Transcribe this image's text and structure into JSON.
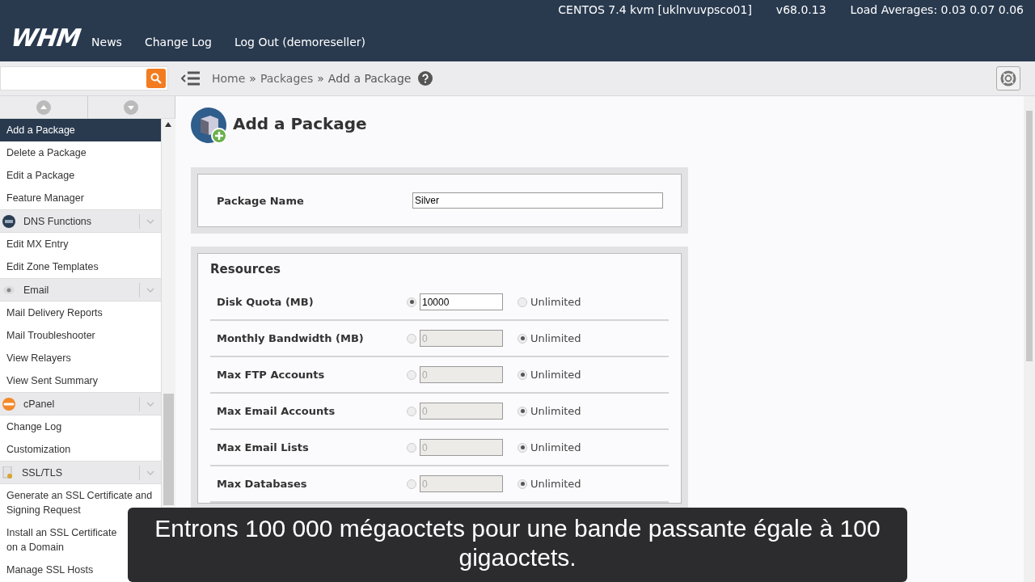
{
  "header": {
    "server_info": "CENTOS 7.4 kvm [uklnvuvpsco01]",
    "version": "v68.0.13",
    "load": "Load Averages: 0.03 0.07 0.06",
    "logo": "WHM",
    "nav": [
      "News",
      "Change Log",
      "Log Out (demoreseller)"
    ]
  },
  "breadcrumb": [
    {
      "kind": "link",
      "text": "Home"
    },
    {
      "kind": "separator",
      "text": "»"
    },
    {
      "kind": "link",
      "text": "Packages"
    },
    {
      "kind": "separator",
      "text": "»"
    },
    {
      "kind": "current",
      "text": "Add a Package"
    }
  ],
  "sidebar": {
    "items": [
      {
        "kind": "link",
        "label": "Add a Package",
        "selected": true
      },
      {
        "kind": "link",
        "label": "Delete a Package",
        "selected": false
      },
      {
        "kind": "link",
        "label": "Edit a Package",
        "selected": false
      },
      {
        "kind": "link",
        "label": "Feature Manager",
        "selected": false
      },
      {
        "kind": "group",
        "label": "DNS Functions"
      },
      {
        "kind": "link",
        "label": "Edit MX Entry",
        "selected": false
      },
      {
        "kind": "link",
        "label": "Edit Zone Templates",
        "selected": false
      },
      {
        "kind": "group",
        "label": "Email"
      },
      {
        "kind": "link",
        "label": "Mail Delivery Reports",
        "selected": false
      },
      {
        "kind": "link",
        "label": "Mail Troubleshooter",
        "selected": false
      },
      {
        "kind": "link",
        "label": "View Relayers",
        "selected": false
      },
      {
        "kind": "link",
        "label": "View Sent Summary",
        "selected": false
      },
      {
        "kind": "group",
        "label": "cPanel"
      },
      {
        "kind": "link",
        "label": "Change Log",
        "selected": false
      },
      {
        "kind": "link",
        "label": "Customization",
        "selected": false
      },
      {
        "kind": "group",
        "label": "SSL/TLS"
      },
      {
        "kind": "link",
        "label": "Generate an SSL Certificate and Signing Request",
        "selected": false
      },
      {
        "kind": "link",
        "label": "Install an SSL Certificate on a Domain",
        "selected": false
      },
      {
        "kind": "link",
        "label": "Manage SSL Hosts",
        "selected": false
      }
    ]
  },
  "page": {
    "title": "Add a Package",
    "package_name": {
      "label": "Package Name",
      "value": "Silver"
    },
    "resources": {
      "title": "Resources",
      "rows": [
        {
          "label": "Disk Quota (MB)",
          "value": "10000",
          "unlimited": false,
          "unlimited_label": "Unlimited"
        },
        {
          "label": "Monthly Bandwidth (MB)",
          "value": "0",
          "unlimited": true,
          "unlimited_label": "Unlimited"
        },
        {
          "label": "Max FTP Accounts",
          "value": "0",
          "unlimited": true,
          "unlimited_label": "Unlimited"
        },
        {
          "label": "Max Email Accounts",
          "value": "0",
          "unlimited": true,
          "unlimited_label": "Unlimited"
        },
        {
          "label": "Max Email Lists",
          "value": "0",
          "unlimited": true,
          "unlimited_label": "Unlimited"
        },
        {
          "label": "Max Databases",
          "value": "0",
          "unlimited": true,
          "unlimited_label": "Unlimited"
        }
      ]
    }
  },
  "caption": "Entrons 100 000 mégaoctets pour une bande passante égale à 100 gigaoctets."
}
